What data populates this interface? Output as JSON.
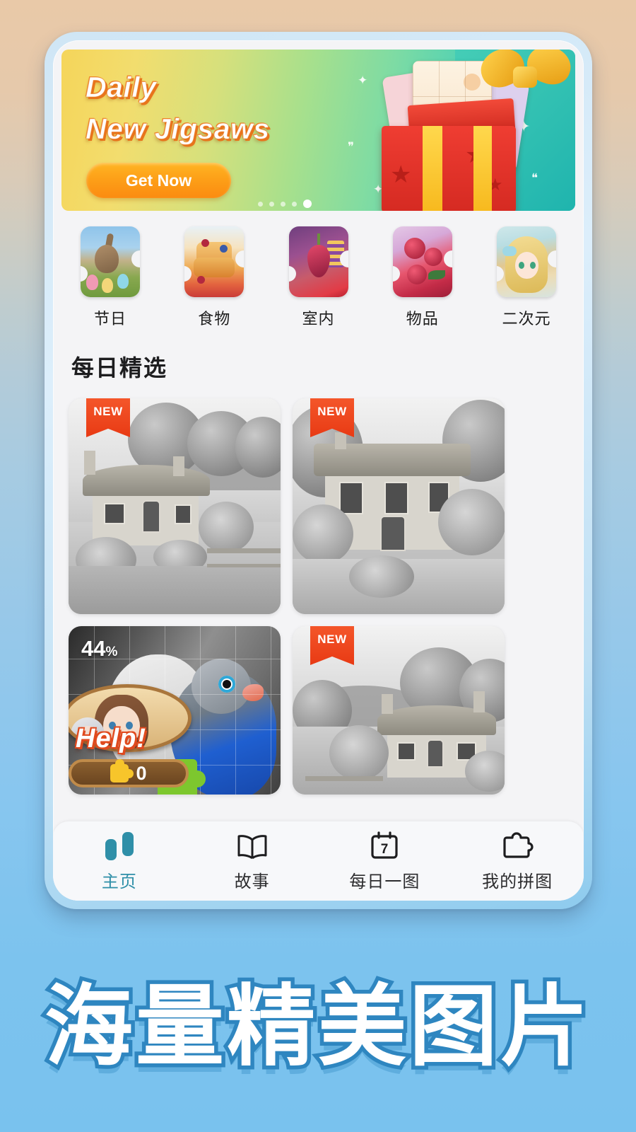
{
  "banner": {
    "title_line1": "Daily",
    "title_line2": "New Jigsaws",
    "cta_label": "Get Now",
    "dots_total": 5,
    "dots_active_index": 4,
    "accent_color": "#fb8b10"
  },
  "categories": [
    {
      "label": "节日",
      "icon": "category-holiday-icon"
    },
    {
      "label": "食物",
      "icon": "category-food-icon"
    },
    {
      "label": "室内",
      "icon": "category-interior-icon"
    },
    {
      "label": "物品",
      "icon": "category-objects-icon"
    },
    {
      "label": "二次元",
      "icon": "category-anime-icon"
    }
  ],
  "daily": {
    "section_title": "每日精选",
    "items": [
      {
        "badge": "NEW",
        "progress": "",
        "artwork": "cottage-by-the-stream"
      },
      {
        "badge": "NEW",
        "progress": "",
        "artwork": "stone-house-with-trees"
      },
      {
        "badge": "",
        "progress": "44",
        "progress_suffix": "%",
        "artwork": "blue-lovebird",
        "help_label": "Help!",
        "coin_count": "0"
      },
      {
        "badge": "NEW",
        "progress": "",
        "artwork": "thatched-cottage-garden"
      }
    ]
  },
  "tabbar": {
    "active_index": 0,
    "active_color": "#2f8fa8",
    "items": [
      {
        "label": "主页",
        "icon": "home-icon"
      },
      {
        "label": "故事",
        "icon": "book-icon"
      },
      {
        "label": "每日一图",
        "icon": "calendar-icon",
        "badge_day": "7"
      },
      {
        "label": "我的拼图",
        "icon": "puzzle-piece-icon"
      }
    ]
  },
  "promo": {
    "headline": "海量精美图片"
  }
}
